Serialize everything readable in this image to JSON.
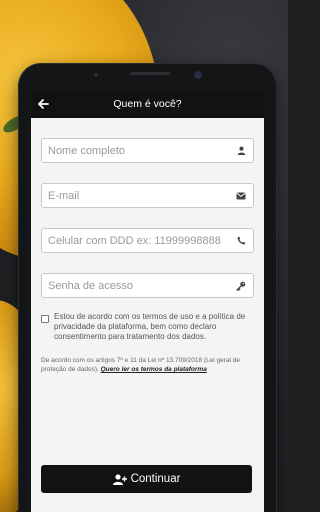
{
  "header": {
    "title": "Quem é você?"
  },
  "form": {
    "name_placeholder": "Nome completo",
    "email_placeholder": "E-mail",
    "phone_placeholder": "Celular com DDD ex: 11999998888",
    "password_placeholder": "Senha de acesso"
  },
  "consent": {
    "text": "Estou de acordo com os termos de uso e a política de privacidade da plataforma, bem como declaro consentimento para tratamento dos dados.",
    "checked": false
  },
  "law": {
    "text": "De acordo com os artigos 7º e 11 da Lei nº 13.709/2018 (Lei geral de proteção de dados). ",
    "link_text": "Quero ler os termos da plataforma"
  },
  "actions": {
    "continue_label": "Continuar"
  },
  "icons": {
    "back": "arrow-left-icon",
    "name": "user-icon",
    "email": "envelope-icon",
    "phone": "phone-icon",
    "password": "key-icon",
    "continue": "user-plus-icon"
  },
  "colors": {
    "topbar": "#111214",
    "screen_bg": "#f4f4f4",
    "button_bg": "#111214"
  }
}
